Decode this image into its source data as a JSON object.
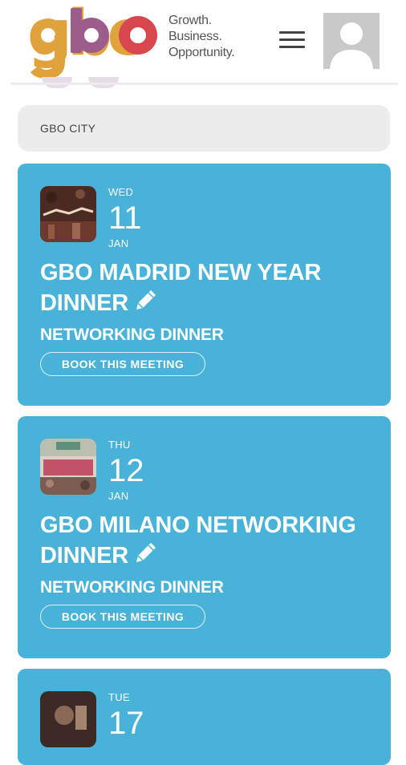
{
  "brand": {
    "logo_text": "gbo",
    "tagline": [
      "Growth.",
      "Business.",
      "Opportunity."
    ]
  },
  "header": {
    "menu_icon": "hamburger-icon",
    "avatar_icon": "user-avatar-icon"
  },
  "filter": {
    "city_label": "GBO CITY"
  },
  "events": [
    {
      "dow": "WED",
      "day": "11",
      "month": "JAN",
      "title": "GBO MADRID NEW YEAR DINNER",
      "category": "NETWORKING DINNER",
      "cta": "BOOK THIS MEETING"
    },
    {
      "dow": "THU",
      "day": "12",
      "month": "JAN",
      "title": "GBO MILANO NETWORKING DINNER",
      "category": "NETWORKING DINNER",
      "cta": "BOOK THIS MEETING"
    },
    {
      "dow": "TUE",
      "day": "17"
    }
  ],
  "colors": {
    "card": "#48b2d8",
    "logo_g": "#e0a23a",
    "logo_b": "#9b5e8c",
    "logo_o": "#d8474f"
  }
}
